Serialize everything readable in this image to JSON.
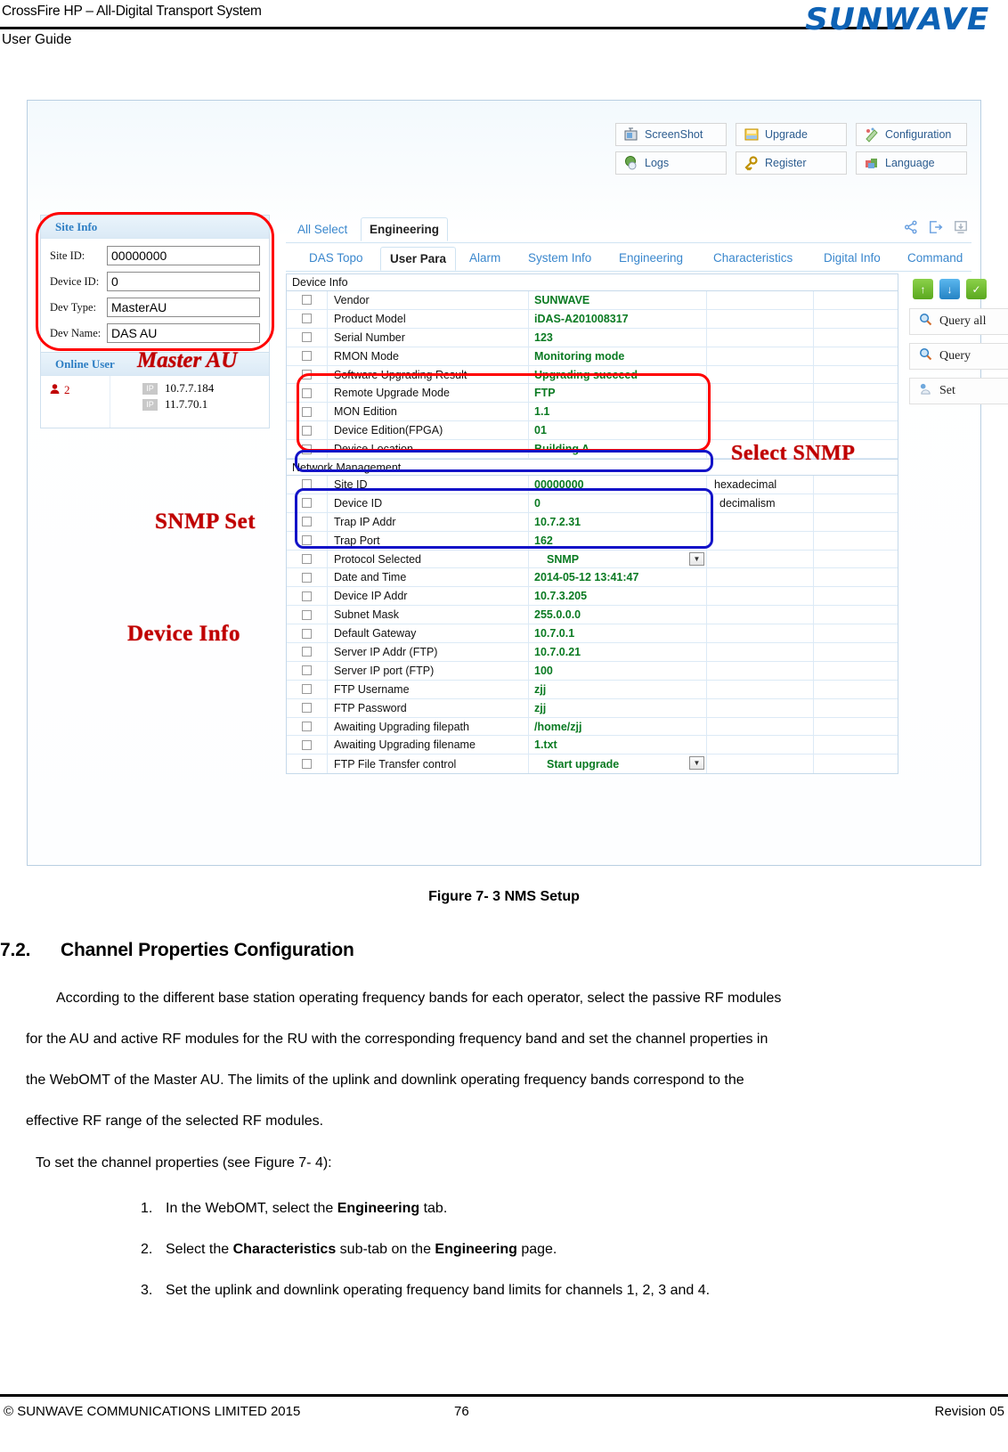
{
  "page_header": {
    "title": "CrossFire HP – All-Digital Transport System",
    "subtitle": "User Guide",
    "logo_text": "SUNWAVE"
  },
  "screenshot": {
    "toolbar": [
      {
        "label": "ScreenShot",
        "icon": "screenshot-icon"
      },
      {
        "label": "Upgrade",
        "icon": "upgrade-icon"
      },
      {
        "label": "Configuration",
        "icon": "configuration-icon"
      },
      {
        "label": "Logs",
        "icon": "logs-icon"
      },
      {
        "label": "Register",
        "icon": "register-icon"
      },
      {
        "label": "Language",
        "icon": "language-icon"
      }
    ],
    "site_info": {
      "panel_title": "Site Info",
      "fields": [
        {
          "label": "Site ID:",
          "value": "00000000"
        },
        {
          "label": "Device ID:",
          "value": "0"
        },
        {
          "label": "Dev Type:",
          "value": "MasterAU"
        },
        {
          "label": "Dev Name:",
          "value": "DAS AU"
        }
      ]
    },
    "online_user": {
      "panel_title": "Online User",
      "count": "2",
      "ips": [
        {
          "badge": "IP",
          "addr": "10.7.7.184"
        },
        {
          "badge": "IP",
          "addr": "11.7.70.1"
        }
      ]
    },
    "annotations": {
      "master_au": "Master AU",
      "snmp_set": "SNMP Set",
      "device_info": "Device Info",
      "select_snmp": "Select SNMP"
    },
    "tabs": [
      {
        "label": "All Select",
        "active": false
      },
      {
        "label": "Engineering",
        "active": true
      }
    ],
    "tab_icons": [
      {
        "name": "share-icon"
      },
      {
        "name": "export-icon"
      },
      {
        "name": "download-icon"
      }
    ],
    "subtabs": [
      {
        "label": "DAS Topo",
        "active": false
      },
      {
        "label": "User Para",
        "active": true
      },
      {
        "label": "Alarm",
        "active": false
      },
      {
        "label": "System Info",
        "active": false
      },
      {
        "label": "Engineering",
        "active": false
      },
      {
        "label": "Characteristics",
        "active": false
      },
      {
        "label": "Digital Info",
        "active": false
      },
      {
        "label": "Command",
        "active": false
      }
    ],
    "grid": {
      "sections": [
        {
          "title": "Device Info",
          "rows": [
            {
              "name": "Vendor",
              "value": "SUNWAVE",
              "unit": "",
              "dropdown": false
            },
            {
              "name": "Product Model",
              "value": "iDAS-A201008317",
              "unit": "",
              "dropdown": false
            },
            {
              "name": "Serial Number",
              "value": "123",
              "unit": "",
              "dropdown": false
            },
            {
              "name": "RMON Mode",
              "value": "Monitoring mode",
              "unit": "",
              "dropdown": false
            },
            {
              "name": "Software Upgrading Result",
              "value": "Upgrading succeed",
              "unit": "",
              "dropdown": false
            },
            {
              "name": "Remote Upgrade Mode",
              "value": "FTP",
              "unit": "",
              "dropdown": false
            },
            {
              "name": "MON Edition",
              "value": "1.1",
              "unit": "",
              "dropdown": false
            },
            {
              "name": "Device Edition(FPGA)",
              "value": "01",
              "unit": "",
              "dropdown": false
            },
            {
              "name": "Device Location",
              "value": "Building A",
              "unit": "",
              "dropdown": false
            }
          ]
        },
        {
          "title": "Network Management",
          "rows": [
            {
              "name": "Site ID",
              "value": "00000000",
              "unit": "hexadecimal",
              "dropdown": false
            },
            {
              "name": "Device ID",
              "value": "0",
              "unit": "decimalism",
              "dropdown": false
            },
            {
              "name": "Trap IP Addr",
              "value": "10.7.2.31",
              "unit": "",
              "dropdown": false
            },
            {
              "name": "Trap Port",
              "value": "162",
              "unit": "",
              "dropdown": false
            },
            {
              "name": "Protocol Selected",
              "value": "SNMP",
              "unit": "",
              "dropdown": true
            },
            {
              "name": "Date and Time",
              "value": "2014-05-12 13:41:47",
              "unit": "",
              "dropdown": false
            },
            {
              "name": "Device IP Addr",
              "value": "10.7.3.205",
              "unit": "",
              "dropdown": false
            },
            {
              "name": "Subnet Mask",
              "value": "255.0.0.0",
              "unit": "",
              "dropdown": false
            },
            {
              "name": "Default Gateway",
              "value": "10.7.0.1",
              "unit": "",
              "dropdown": false
            },
            {
              "name": "Server IP Addr (FTP)",
              "value": "10.7.0.21",
              "unit": "",
              "dropdown": false
            },
            {
              "name": "Server IP port (FTP)",
              "value": "100",
              "unit": "",
              "dropdown": false
            },
            {
              "name": "FTP Username",
              "value": "zjj",
              "unit": "",
              "dropdown": false
            },
            {
              "name": "FTP Password",
              "value": "zjj",
              "unit": "",
              "dropdown": false
            },
            {
              "name": "Awaiting Upgrading filepath",
              "value": "/home/zjj",
              "unit": "",
              "dropdown": false
            },
            {
              "name": "Awaiting Upgrading filename",
              "value": "1.txt",
              "unit": "",
              "dropdown": false
            },
            {
              "name": "FTP File Transfer control",
              "value": "Start upgrade",
              "unit": "",
              "dropdown": true
            }
          ]
        }
      ]
    },
    "side_buttons": {
      "mini_icons": [
        {
          "name": "upload-icon",
          "glyph": "↑",
          "color": "#5aa81f"
        },
        {
          "name": "download-icon",
          "glyph": "↓",
          "color": "#2583c4"
        },
        {
          "name": "check-icon",
          "glyph": "✓",
          "color": "#5aa81f"
        }
      ],
      "buttons": [
        {
          "label": "Query all",
          "icon": "magnifier-icon"
        },
        {
          "label": "Query",
          "icon": "magnifier-icon"
        },
        {
          "label": "Set",
          "icon": "set-icon"
        }
      ]
    }
  },
  "figure_caption": "Figure 7- 3 NMS Setup",
  "section": {
    "number": "7.2.",
    "title": "Channel Properties Configuration"
  },
  "paragraphs": [
    "According to the different base station operating frequency bands for each operator, select the passive RF modules",
    "for the AU and active RF modules for the RU with the corresponding frequency band and set the channel properties in",
    "the WebOMT of the Master AU. The limits of the uplink and downlink operating frequency bands correspond to the",
    "effective RF range of the selected RF modules."
  ],
  "intro_line": "To set the channel properties (see Figure 7- 4):",
  "steps": [
    {
      "n": "1.",
      "pre": "In the WebOMT, select the ",
      "bold": "Engineering",
      "post": " tab.",
      "bold2": "",
      "post2": ""
    },
    {
      "n": "2.",
      "pre": "Select the ",
      "bold": "Characteristics",
      "post": " sub-tab on the ",
      "bold2": "Engineering",
      "post2": " page."
    },
    {
      "n": "3.",
      "pre": "Set the uplink and downlink operating frequency band limits for channels 1, 2, 3 and 4.",
      "bold": "",
      "post": "",
      "bold2": "",
      "post2": ""
    }
  ],
  "footer": {
    "left": "© SUNWAVE COMMUNICATIONS LIMITED 2015",
    "center": "76",
    "right": "Revision 05"
  }
}
